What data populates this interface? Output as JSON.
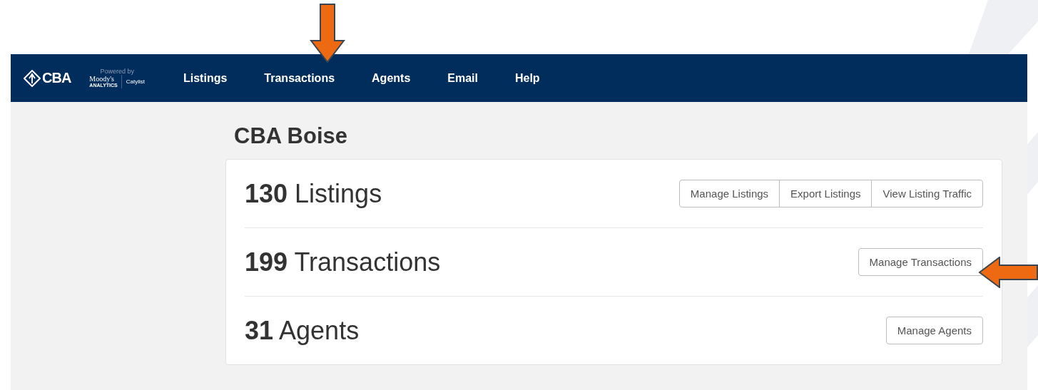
{
  "header": {
    "logo": "CBA",
    "powered_by": "Powered by",
    "partner": "Moody's",
    "partner_sub": "ANALYTICS",
    "product": "Catylist"
  },
  "nav": [
    {
      "label": "Listings"
    },
    {
      "label": "Transactions"
    },
    {
      "label": "Agents"
    },
    {
      "label": "Email"
    },
    {
      "label": "Help"
    }
  ],
  "page_title": "CBA Boise",
  "stats": [
    {
      "count": "130",
      "label": "Listings",
      "buttons": [
        "Manage Listings",
        "Export Listings",
        "View Listing Traffic"
      ]
    },
    {
      "count": "199",
      "label": "Transactions",
      "buttons": [
        "Manage Transactions"
      ]
    },
    {
      "count": "31",
      "label": "Agents",
      "buttons": [
        "Manage Agents"
      ]
    }
  ]
}
